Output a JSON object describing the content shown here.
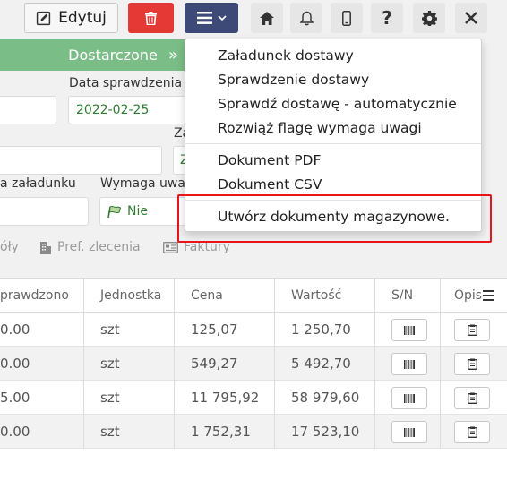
{
  "toolbar": {
    "edit_label": "Edytuj",
    "icons": [
      "edit-icon",
      "trash-icon",
      "hamburger-icon",
      "chevron-down-icon",
      "home-icon",
      "bell-icon",
      "mobile-icon",
      "help-icon",
      "gear-icon",
      "close-icon"
    ]
  },
  "status": {
    "label": "Dostarczone",
    "arrow": "»"
  },
  "form": {
    "data_sprawdzenia_label": "Data sprawdzenia",
    "data_sprawdzenia_value": "2022-02-25",
    "za_label": "Za",
    "z_value": "Z",
    "zaladunku_label": "a załadunku",
    "wymaga_uwagi_label": "Wymaga uwag",
    "wymaga_uwagi_value": "Nie"
  },
  "tabs": [
    {
      "label": "óły"
    },
    {
      "label": "Pref. zlecenia"
    },
    {
      "label": "Faktury"
    }
  ],
  "table": {
    "columns": [
      "prawdzono",
      "Jednostka",
      "Cena",
      "Wartość",
      "S/N",
      "Opis"
    ],
    "rows": [
      {
        "sprawdzono": "0.00",
        "jednostka": "szt",
        "cena": "125,07",
        "wartosc": "1 250,70"
      },
      {
        "sprawdzono": "0.00",
        "jednostka": "szt",
        "cena": "549,27",
        "wartosc": "5 492,70"
      },
      {
        "sprawdzono": "5.00",
        "jednostka": "szt",
        "cena": "11 795,92",
        "wartosc": "58 979,60"
      },
      {
        "sprawdzono": "0.00",
        "jednostka": "szt",
        "cena": "1 752,31",
        "wartosc": "17 523,10"
      }
    ]
  },
  "dropdown": {
    "items": [
      "Załadunek dostawy",
      "Sprawdzenie dostawy",
      "Sprawdź dostawę - automatycznie",
      "Rozwiąż flagę wymaga uwagi",
      "Dokument PDF",
      "Dokument CSV",
      "Utwórz dokumenty magazynowe."
    ]
  },
  "colors": {
    "delete": "#e53935",
    "menu": "#3d4a78",
    "status": "#7bbd86",
    "highlight": "#e8141b",
    "date_text": "#2e7d32"
  }
}
